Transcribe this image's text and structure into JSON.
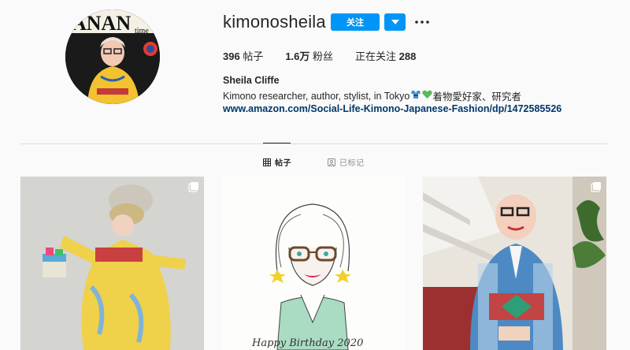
{
  "profile": {
    "username": "kimonosheila",
    "follow_label": "关注",
    "full_name": "Sheila Cliffe",
    "bio": "Kimono researcher, author, stylist, in Tokyo",
    "bio_suffix": " 着物愛好家、研究者",
    "link": "www.amazon.com/Social-Life-Kimono-Japanese-Fashion/dp/1472585526",
    "avatar_text": "ANAN",
    "avatar_text2": "time"
  },
  "stats": {
    "posts_count": "396",
    "posts_label": " 帖子",
    "followers_count": "1.6万",
    "followers_label": " 粉丝",
    "following_label": "正在关注 ",
    "following_count": "288"
  },
  "tabs": {
    "posts_label": "帖子",
    "tagged_label": "已标记"
  },
  "posts": [
    {
      "caption_visible": "",
      "multi": true
    },
    {
      "caption_visible": "Happy Birthday 2020",
      "multi": false
    },
    {
      "caption_visible": "",
      "multi": true
    }
  ],
  "colors": {
    "accent": "#0095f6",
    "link": "#00376b",
    "background": "#fafafa",
    "divider": "#dbdbdb"
  },
  "icons": {
    "dropdown": "chevron-down-icon",
    "more": "more-horizontal-icon",
    "grid": "grid-icon",
    "tagged": "tagged-icon",
    "multi": "carousel-icon"
  }
}
